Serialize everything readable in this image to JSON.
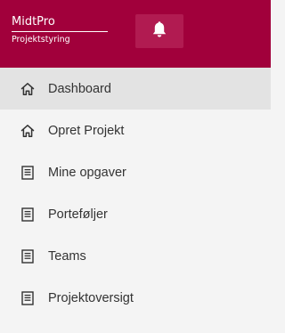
{
  "header": {
    "brand_name": "MidtPro",
    "brand_sub": "Projektstyring",
    "notification_icon": "bell-icon",
    "brand_color": "#a1003b"
  },
  "nav": {
    "items": [
      {
        "label": "Dashboard",
        "icon": "home-icon",
        "active": true
      },
      {
        "label": "Opret Projekt",
        "icon": "home-icon",
        "active": false
      },
      {
        "label": "Mine opgaver",
        "icon": "document-icon",
        "active": false
      },
      {
        "label": "Porteføljer",
        "icon": "document-icon",
        "active": false
      },
      {
        "label": "Teams",
        "icon": "document-icon",
        "active": false
      },
      {
        "label": "Projektoversigt",
        "icon": "document-icon",
        "active": false
      }
    ]
  }
}
